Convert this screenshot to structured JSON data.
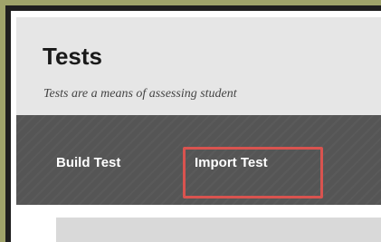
{
  "header": {
    "title": "Tests",
    "subtitle": "Tests are a means of assessing student"
  },
  "toolbar": {
    "build_label": "Build Test",
    "import_label": "Import Test"
  },
  "colors": {
    "outer_background": "#9fa36a",
    "frame_border": "#1e1e1e",
    "header_background": "#e6e6e6",
    "toolbar_background": "#555555",
    "highlight": "#d9534f",
    "content_placeholder": "#d9d9d9"
  }
}
